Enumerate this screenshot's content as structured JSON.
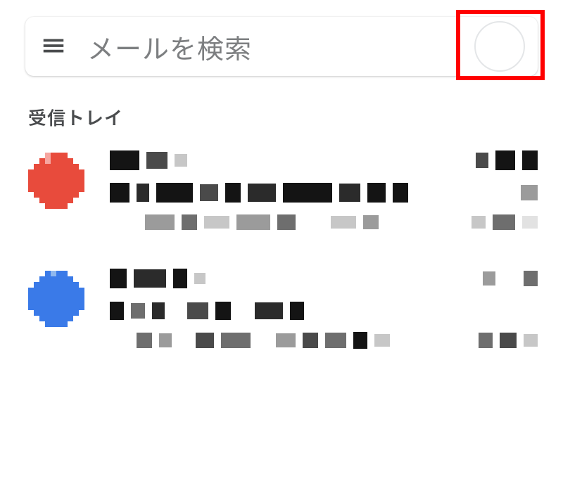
{
  "search": {
    "placeholder": "メールを検索"
  },
  "section_label": "受信トレイ",
  "avatar_colors": {
    "item0": "#e84b3c",
    "item1": "#3a7ae8"
  }
}
